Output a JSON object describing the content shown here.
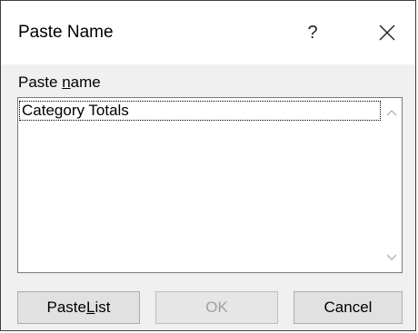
{
  "dialog": {
    "title": "Paste Name",
    "help_glyph": "?",
    "close_icon": "close-icon"
  },
  "list": {
    "label_prefix": "Paste ",
    "label_accel": "n",
    "label_suffix": "ame",
    "items": [
      "Category Totals"
    ],
    "selected_index": 0
  },
  "buttons": {
    "paste_list_prefix": "Paste ",
    "paste_list_accel": "L",
    "paste_list_suffix": "ist",
    "ok": "OK",
    "cancel": "Cancel"
  },
  "colors": {
    "focus_border": "#2a6fdb",
    "disabled_text": "#a0a0a0"
  }
}
